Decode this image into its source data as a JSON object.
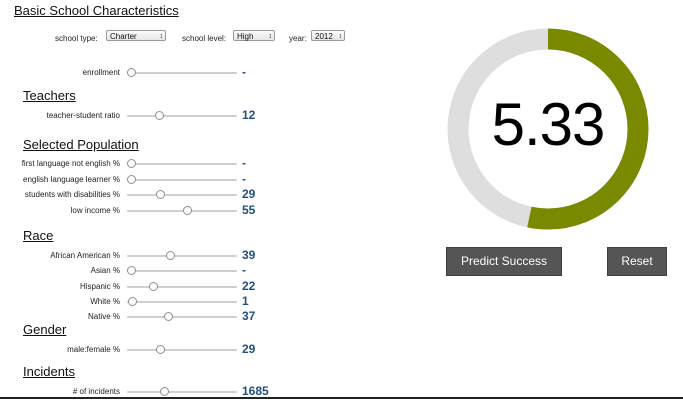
{
  "basic": {
    "title": "Basic School Characteristics",
    "school_type": {
      "label": "school type:",
      "value": "Charter"
    },
    "school_level": {
      "label": "school level:",
      "value": "High"
    },
    "year": {
      "label": "year:",
      "value": "2012"
    },
    "enrollment": {
      "label": "enrollment",
      "value": "-",
      "level": 0.0
    }
  },
  "teachers": {
    "title": "Teachers",
    "ratio": {
      "label": "teacher-student ratio",
      "value": "12",
      "level": 0.28
    }
  },
  "population": {
    "title": "Selected Population",
    "items": [
      {
        "label": "first language not english %",
        "value": "-",
        "level": 0.0
      },
      {
        "label": "english language learner %",
        "value": "-",
        "level": 0.0
      },
      {
        "label": "students with disabilities %",
        "value": "29",
        "level": 0.29
      },
      {
        "label": "low income %",
        "value": "55",
        "level": 0.55
      }
    ]
  },
  "race": {
    "title": "Race",
    "items": [
      {
        "label": "African American %",
        "value": "39",
        "level": 0.39
      },
      {
        "label": "Asian %",
        "value": "-",
        "level": 0.0
      },
      {
        "label": "Hispanic %",
        "value": "22",
        "level": 0.22
      },
      {
        "label": "White %",
        "value": "1",
        "level": 0.01
      },
      {
        "label": "Native %",
        "value": "37",
        "level": 0.37
      }
    ]
  },
  "gender": {
    "title": "Gender",
    "ratio": {
      "label": "male:female %",
      "value": "29",
      "level": 0.29
    }
  },
  "incidents": {
    "title": "Incidents",
    "count": {
      "label": "# of incidents",
      "value": "1685",
      "level": 0.33
    }
  },
  "score": {
    "value": "5.33",
    "fraction": 0.533,
    "fill_color": "#7a8a00",
    "track_color": "#dedede"
  },
  "buttons": {
    "predict": "Predict Success",
    "reset": "Reset"
  }
}
